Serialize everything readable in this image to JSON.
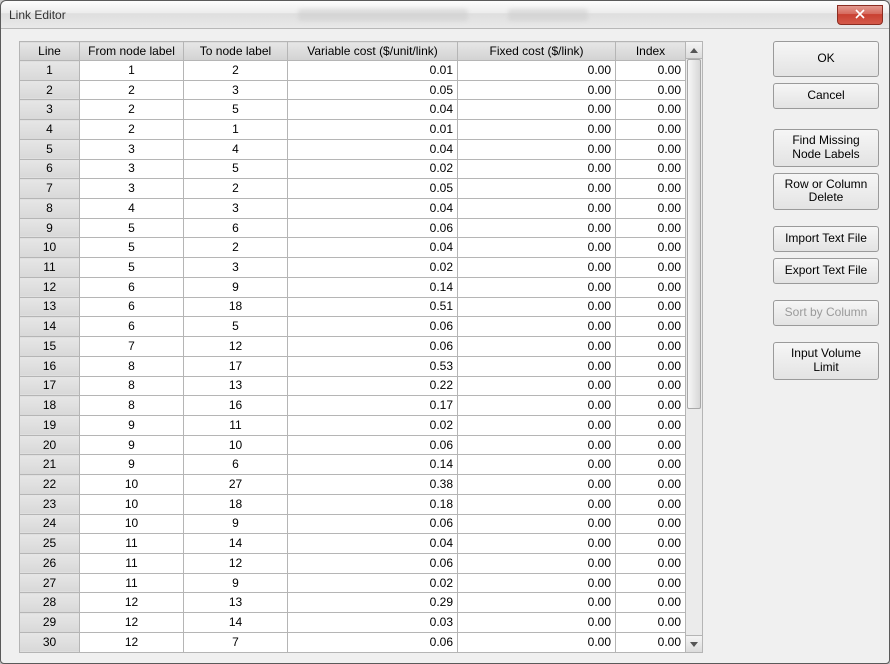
{
  "window": {
    "title": "Link Editor"
  },
  "columns": {
    "line": "Line",
    "from": "From node label",
    "to": "To node label",
    "varcost": "Variable cost ($/unit/link)",
    "fixedcost": "Fixed cost ($/link)",
    "index": "Index"
  },
  "rows": [
    {
      "line": "1",
      "from": "1",
      "to": "2",
      "var": "0.01",
      "fixed": "0.00",
      "index": "0.00"
    },
    {
      "line": "2",
      "from": "2",
      "to": "3",
      "var": "0.05",
      "fixed": "0.00",
      "index": "0.00"
    },
    {
      "line": "3",
      "from": "2",
      "to": "5",
      "var": "0.04",
      "fixed": "0.00",
      "index": "0.00"
    },
    {
      "line": "4",
      "from": "2",
      "to": "1",
      "var": "0.01",
      "fixed": "0.00",
      "index": "0.00"
    },
    {
      "line": "5",
      "from": "3",
      "to": "4",
      "var": "0.04",
      "fixed": "0.00",
      "index": "0.00"
    },
    {
      "line": "6",
      "from": "3",
      "to": "5",
      "var": "0.02",
      "fixed": "0.00",
      "index": "0.00"
    },
    {
      "line": "7",
      "from": "3",
      "to": "2",
      "var": "0.05",
      "fixed": "0.00",
      "index": "0.00"
    },
    {
      "line": "8",
      "from": "4",
      "to": "3",
      "var": "0.04",
      "fixed": "0.00",
      "index": "0.00"
    },
    {
      "line": "9",
      "from": "5",
      "to": "6",
      "var": "0.06",
      "fixed": "0.00",
      "index": "0.00"
    },
    {
      "line": "10",
      "from": "5",
      "to": "2",
      "var": "0.04",
      "fixed": "0.00",
      "index": "0.00"
    },
    {
      "line": "11",
      "from": "5",
      "to": "3",
      "var": "0.02",
      "fixed": "0.00",
      "index": "0.00"
    },
    {
      "line": "12",
      "from": "6",
      "to": "9",
      "var": "0.14",
      "fixed": "0.00",
      "index": "0.00"
    },
    {
      "line": "13",
      "from": "6",
      "to": "18",
      "var": "0.51",
      "fixed": "0.00",
      "index": "0.00"
    },
    {
      "line": "14",
      "from": "6",
      "to": "5",
      "var": "0.06",
      "fixed": "0.00",
      "index": "0.00"
    },
    {
      "line": "15",
      "from": "7",
      "to": "12",
      "var": "0.06",
      "fixed": "0.00",
      "index": "0.00"
    },
    {
      "line": "16",
      "from": "8",
      "to": "17",
      "var": "0.53",
      "fixed": "0.00",
      "index": "0.00"
    },
    {
      "line": "17",
      "from": "8",
      "to": "13",
      "var": "0.22",
      "fixed": "0.00",
      "index": "0.00"
    },
    {
      "line": "18",
      "from": "8",
      "to": "16",
      "var": "0.17",
      "fixed": "0.00",
      "index": "0.00"
    },
    {
      "line": "19",
      "from": "9",
      "to": "11",
      "var": "0.02",
      "fixed": "0.00",
      "index": "0.00"
    },
    {
      "line": "20",
      "from": "9",
      "to": "10",
      "var": "0.06",
      "fixed": "0.00",
      "index": "0.00"
    },
    {
      "line": "21",
      "from": "9",
      "to": "6",
      "var": "0.14",
      "fixed": "0.00",
      "index": "0.00"
    },
    {
      "line": "22",
      "from": "10",
      "to": "27",
      "var": "0.38",
      "fixed": "0.00",
      "index": "0.00"
    },
    {
      "line": "23",
      "from": "10",
      "to": "18",
      "var": "0.18",
      "fixed": "0.00",
      "index": "0.00"
    },
    {
      "line": "24",
      "from": "10",
      "to": "9",
      "var": "0.06",
      "fixed": "0.00",
      "index": "0.00"
    },
    {
      "line": "25",
      "from": "11",
      "to": "14",
      "var": "0.04",
      "fixed": "0.00",
      "index": "0.00"
    },
    {
      "line": "26",
      "from": "11",
      "to": "12",
      "var": "0.06",
      "fixed": "0.00",
      "index": "0.00"
    },
    {
      "line": "27",
      "from": "11",
      "to": "9",
      "var": "0.02",
      "fixed": "0.00",
      "index": "0.00"
    },
    {
      "line": "28",
      "from": "12",
      "to": "13",
      "var": "0.29",
      "fixed": "0.00",
      "index": "0.00"
    },
    {
      "line": "29",
      "from": "12",
      "to": "14",
      "var": "0.03",
      "fixed": "0.00",
      "index": "0.00"
    },
    {
      "line": "30",
      "from": "12",
      "to": "7",
      "var": "0.06",
      "fixed": "0.00",
      "index": "0.00"
    }
  ],
  "buttons": {
    "ok": "OK",
    "cancel": "Cancel",
    "find_missing_labels_l1": "Find Missing",
    "find_missing_labels_l2": "Node Labels",
    "row_col_delete_l1": "Row or Column",
    "row_col_delete_l2": "Delete",
    "import_text": "Import Text File",
    "export_text": "Export Text File",
    "sort_by_column": "Sort by Column",
    "input_volume_l1": "Input Volume",
    "input_volume_l2": "Limit"
  }
}
